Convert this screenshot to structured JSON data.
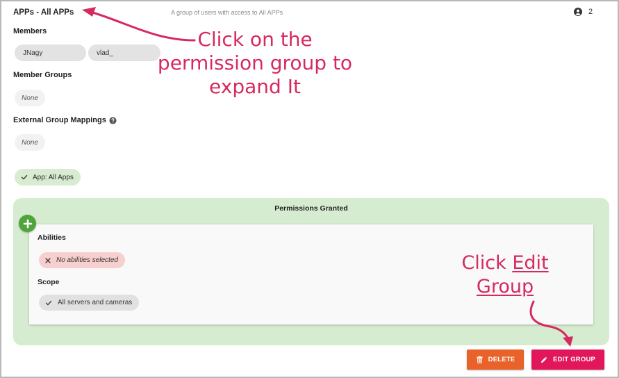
{
  "group": {
    "title": "APPs - All APPs",
    "description": "A group of users with access to All APPs",
    "member_count": "2",
    "count_icon": "user-circle-icon"
  },
  "members": {
    "label": "Members",
    "items": [
      "JNagy",
      "vlad_"
    ]
  },
  "member_groups": {
    "label": "Member Groups",
    "value": "None"
  },
  "external_mappings": {
    "label": "External Group Mappings",
    "value": "None",
    "help_icon": "help-circle-icon"
  },
  "app_chip": {
    "label": "App: All Apps"
  },
  "permissions": {
    "title": "Permissions Granted",
    "abilities_label": "Abilities",
    "abilities_value": "No abilities selected",
    "scope_label": "Scope",
    "scope_value": "All servers and cameras"
  },
  "actions": {
    "delete_label": "DELETE",
    "edit_label": "EDIT GROUP"
  },
  "annotations": {
    "callout_expand": [
      "Click on the",
      "permission group to",
      "expand It"
    ],
    "callout_edit_prefix": "Click ",
    "callout_edit_word": "Edit",
    "callout_edit_line2": "Group"
  },
  "colors": {
    "annotation": "#d62a5f",
    "permissions_bg": "#d6ecd0",
    "add_button": "#4fa53a",
    "delete_button": "#e8622a",
    "edit_button": "#e2165a",
    "no_abilities_chip": "#f8cfcf"
  }
}
